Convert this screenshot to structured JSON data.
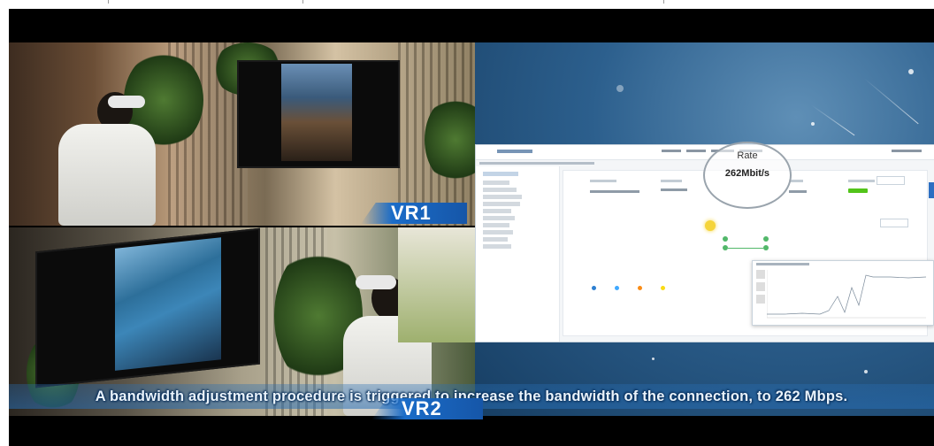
{
  "feeds": {
    "top_label": "VR1",
    "bottom_label": "VR2"
  },
  "app": {
    "rate_title": "Rate",
    "rate_value": "262Mbit/s"
  },
  "subtitle": "A bandwidth adjustment procedure is triggered to increase the bandwidth of the connection, to 262 Mbps.",
  "colors": {
    "tag_blue": "#1a6cc8",
    "share_bg": "#2c5f8d",
    "status_green": "#52c41a"
  },
  "icons": {
    "cursor": "cursor-highlight-icon",
    "node": "network-node-icon"
  }
}
